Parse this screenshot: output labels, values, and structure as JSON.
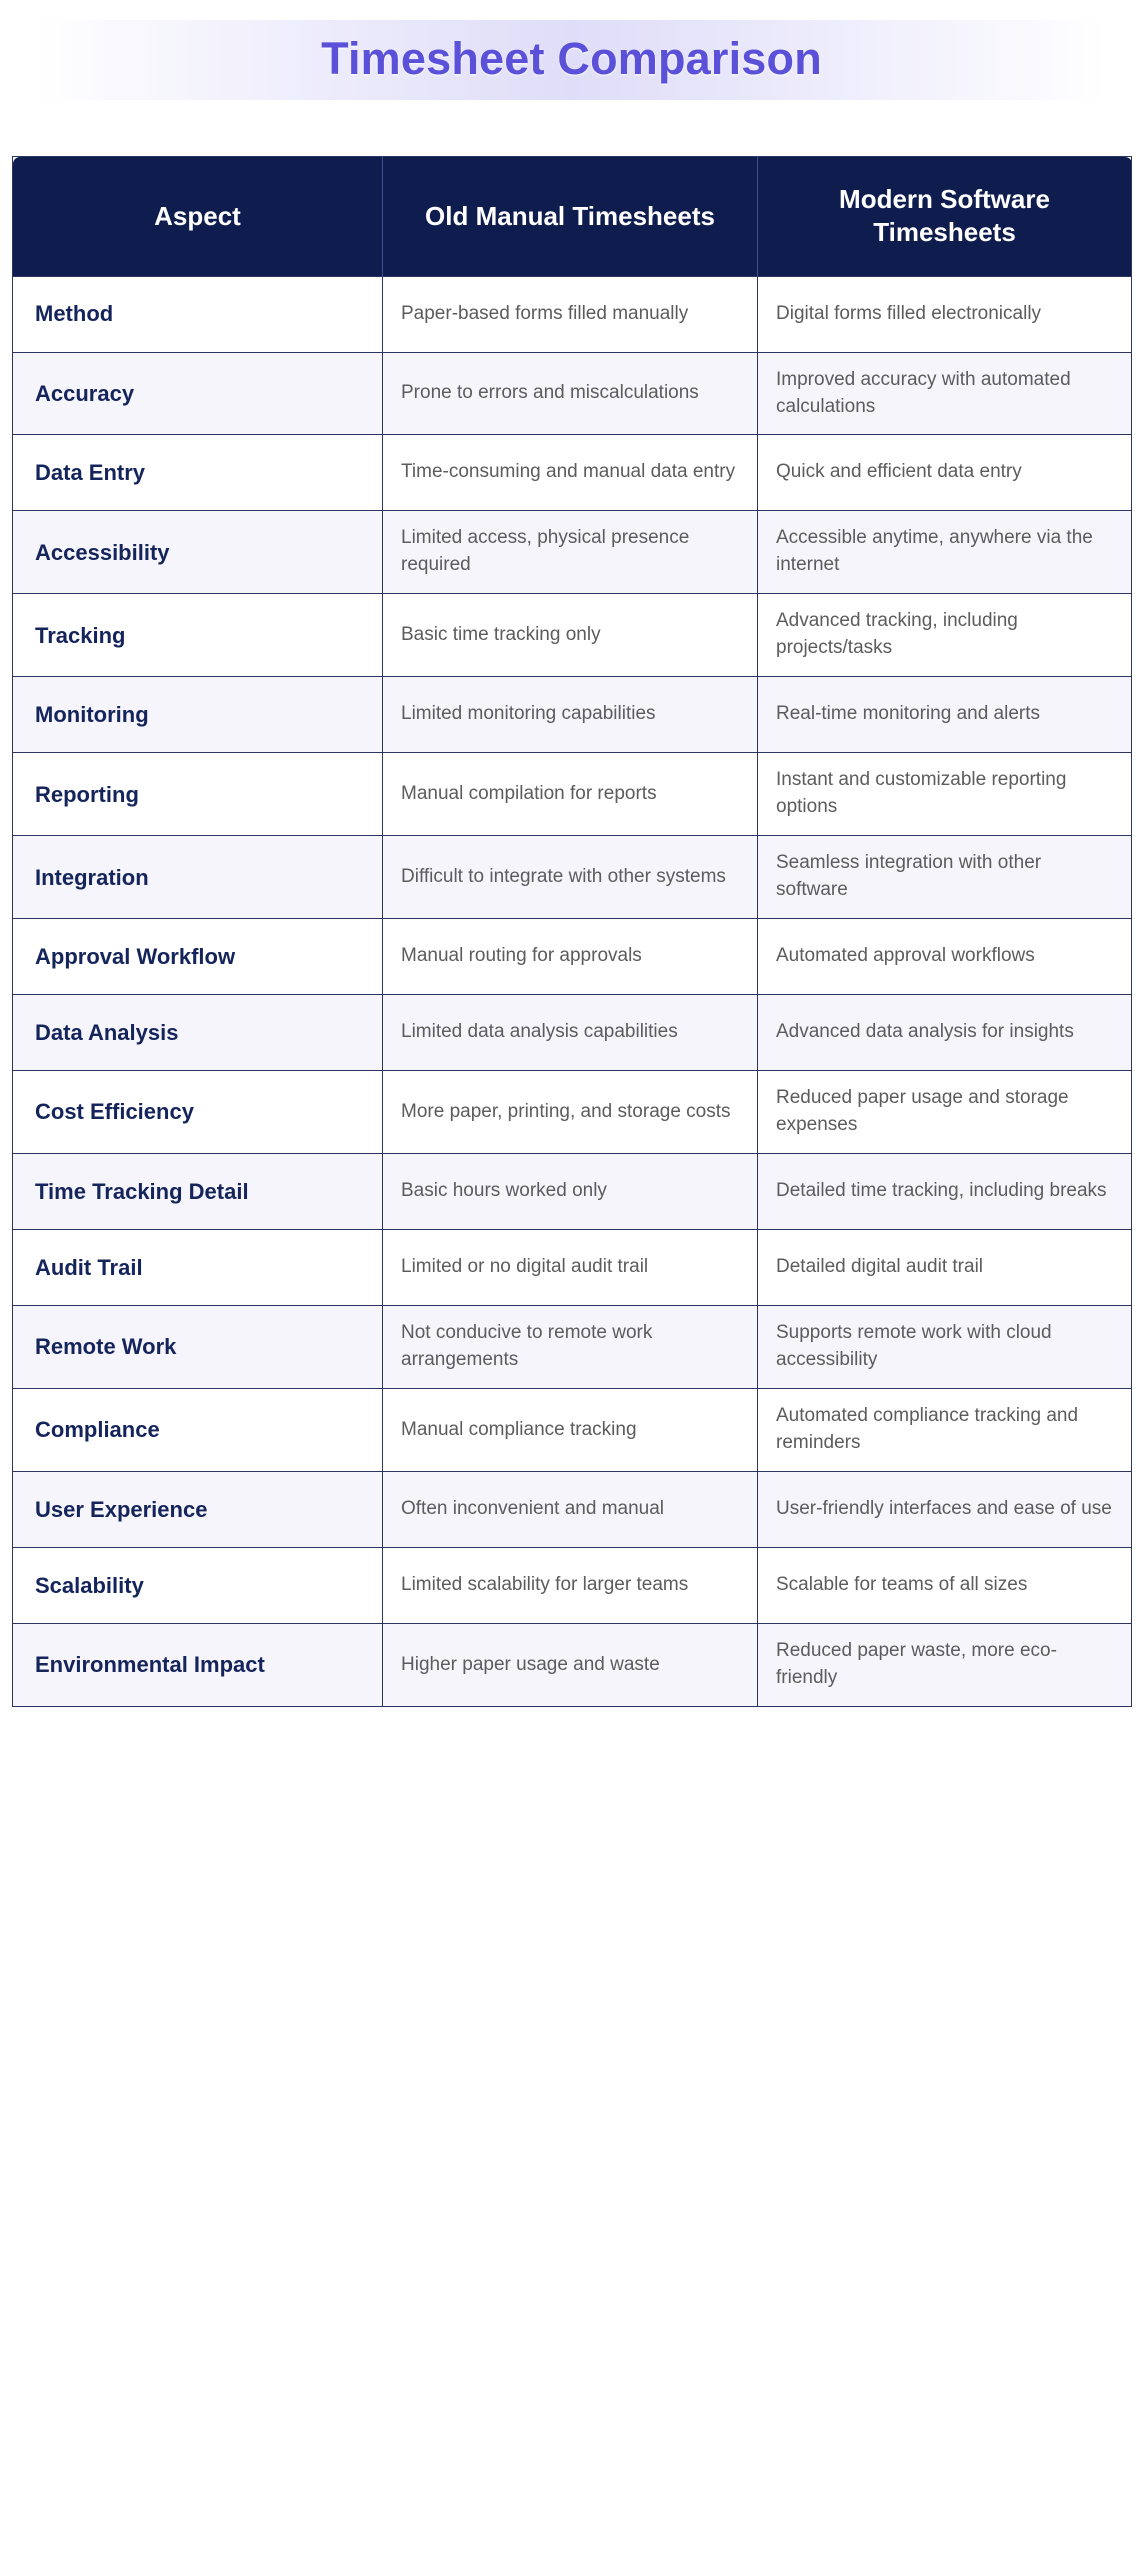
{
  "title": "Timesheet Comparison",
  "colors": {
    "title_text": "#5b51d8",
    "header_bg": "#0e1c4e",
    "header_text": "#ffffff",
    "aspect_text": "#15255c",
    "cell_text": "#5c5c5c",
    "row_alt_bg": "#f5f5fb",
    "border": "#2b3560"
  },
  "table": {
    "headers": {
      "aspect": "Aspect",
      "old": "Old Manual Timesheets",
      "modern": "Modern Software Timesheets"
    },
    "rows": [
      {
        "aspect": "Method",
        "old": "Paper-based forms filled manually",
        "modern": "Digital forms filled electronically"
      },
      {
        "aspect": "Accuracy",
        "old": "Prone to errors and miscalculations",
        "modern": "Improved accuracy with automated calculations"
      },
      {
        "aspect": "Data Entry",
        "old": "Time-consuming and manual data entry",
        "modern": "Quick and efficient data entry"
      },
      {
        "aspect": "Accessibility",
        "old": "Limited access, physical presence required",
        "modern": "Accessible anytime, anywhere via the internet"
      },
      {
        "aspect": "Tracking",
        "old": "Basic time tracking only",
        "modern": "Advanced tracking, including projects/tasks"
      },
      {
        "aspect": "Monitoring",
        "old": "Limited monitoring capabilities",
        "modern": "Real-time monitoring and alerts"
      },
      {
        "aspect": "Reporting",
        "old": "Manual compilation for reports",
        "modern": "Instant and customizable reporting options"
      },
      {
        "aspect": "Integration",
        "old": "Difficult to integrate with other systems",
        "modern": "Seamless integration with other software"
      },
      {
        "aspect": "Approval Workflow",
        "old": "Manual routing for approvals",
        "modern": "Automated approval workflows"
      },
      {
        "aspect": "Data Analysis",
        "old": "Limited data analysis capabilities",
        "modern": "Advanced data analysis for insights"
      },
      {
        "aspect": "Cost Efficiency",
        "old": "More paper, printing, and storage costs",
        "modern": "Reduced paper usage and storage expenses"
      },
      {
        "aspect": "Time Tracking Detail",
        "old": "Basic hours worked only",
        "modern": "Detailed time tracking, including breaks"
      },
      {
        "aspect": "Audit Trail",
        "old": "Limited or no digital audit trail",
        "modern": "Detailed digital audit trail"
      },
      {
        "aspect": "Remote Work",
        "old": "Not conducive to remote work arrangements",
        "modern": "Supports remote work with cloud accessibility"
      },
      {
        "aspect": "Compliance",
        "old": "Manual compliance tracking",
        "modern": "Automated compliance tracking and reminders"
      },
      {
        "aspect": "User Experience",
        "old": "Often inconvenient and manual",
        "modern": "User-friendly interfaces and ease of use"
      },
      {
        "aspect": "Scalability",
        "old": "Limited scalability for larger teams",
        "modern": "Scalable for teams of all sizes"
      },
      {
        "aspect": "Environmental Impact",
        "old": "Higher paper usage and waste",
        "modern": "Reduced paper waste, more eco-friendly"
      }
    ]
  }
}
